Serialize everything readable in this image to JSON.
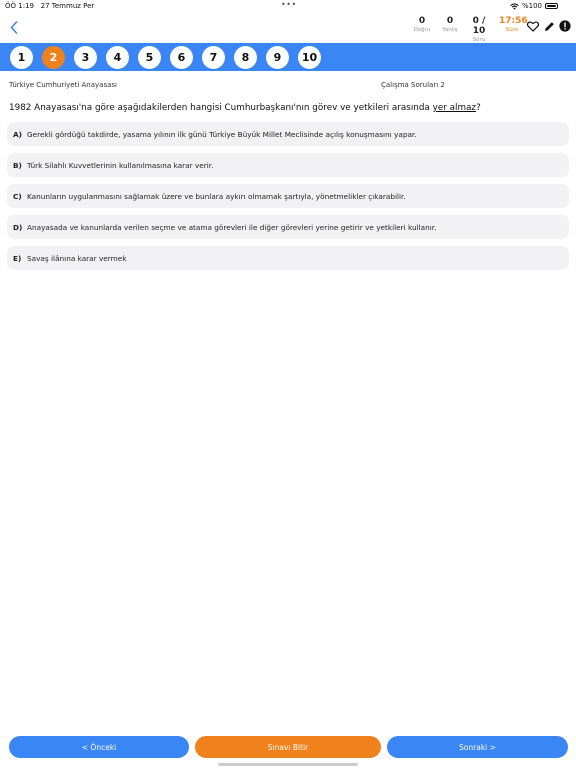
{
  "status_bar": {
    "time": "ÖÖ 1:19",
    "date": "27 Temmuz Per",
    "battery": "%100"
  },
  "stats": {
    "correct": {
      "value": "0",
      "label": "Doğru"
    },
    "wrong": {
      "value": "0",
      "label": "Yanlış"
    },
    "question": {
      "value": "0 / 10",
      "label": "Soru"
    },
    "time": {
      "value": "17:56",
      "label": "Süre"
    }
  },
  "colors": {
    "accent_blue": "#3a86f5",
    "accent_orange": "#f0821e"
  },
  "question_numbers": [
    "1",
    "2",
    "3",
    "4",
    "5",
    "6",
    "7",
    "8",
    "9",
    "10"
  ],
  "active_question": 2,
  "info": {
    "subject": "Türkiye Cumhuriyeti Anayasası",
    "set": "Çalışma Soruları 2"
  },
  "question": {
    "text_before": "1982 Anayasası'na göre aşağıdakilerden hangisi Cumhurbaşkanı'nın görev ve yetkileri arasında ",
    "text_underlined": "yer almaz",
    "text_after": "?"
  },
  "options": [
    {
      "letter": "A)",
      "text": "Gerekli gördüğü takdirde, yasama yılının ilk günü Türkiye Büyük Millet Meclisinde açılış konuşmasını yapar."
    },
    {
      "letter": "B)",
      "text": "Türk Silahlı Kuvvetlerinin kullanılmasına karar verir."
    },
    {
      "letter": "C)",
      "text": "Kanunların uygulanmasını sağlamak üzere ve bunlara aykırı olmamak şartıyla, yönetmelikler çıkarabilir."
    },
    {
      "letter": "D)",
      "text": "Anayasada ve kanunlarda verilen seçme ve atama görevleri ile diğer görevleri yerine getirir ve yetkileri kullanır."
    },
    {
      "letter": "E)",
      "text": "Savaş ilânına karar vermek"
    }
  ],
  "footer": {
    "prev_label": "< Önceki",
    "finish_label": "Sınavı Bitir",
    "next_label": "Sonraki >"
  }
}
